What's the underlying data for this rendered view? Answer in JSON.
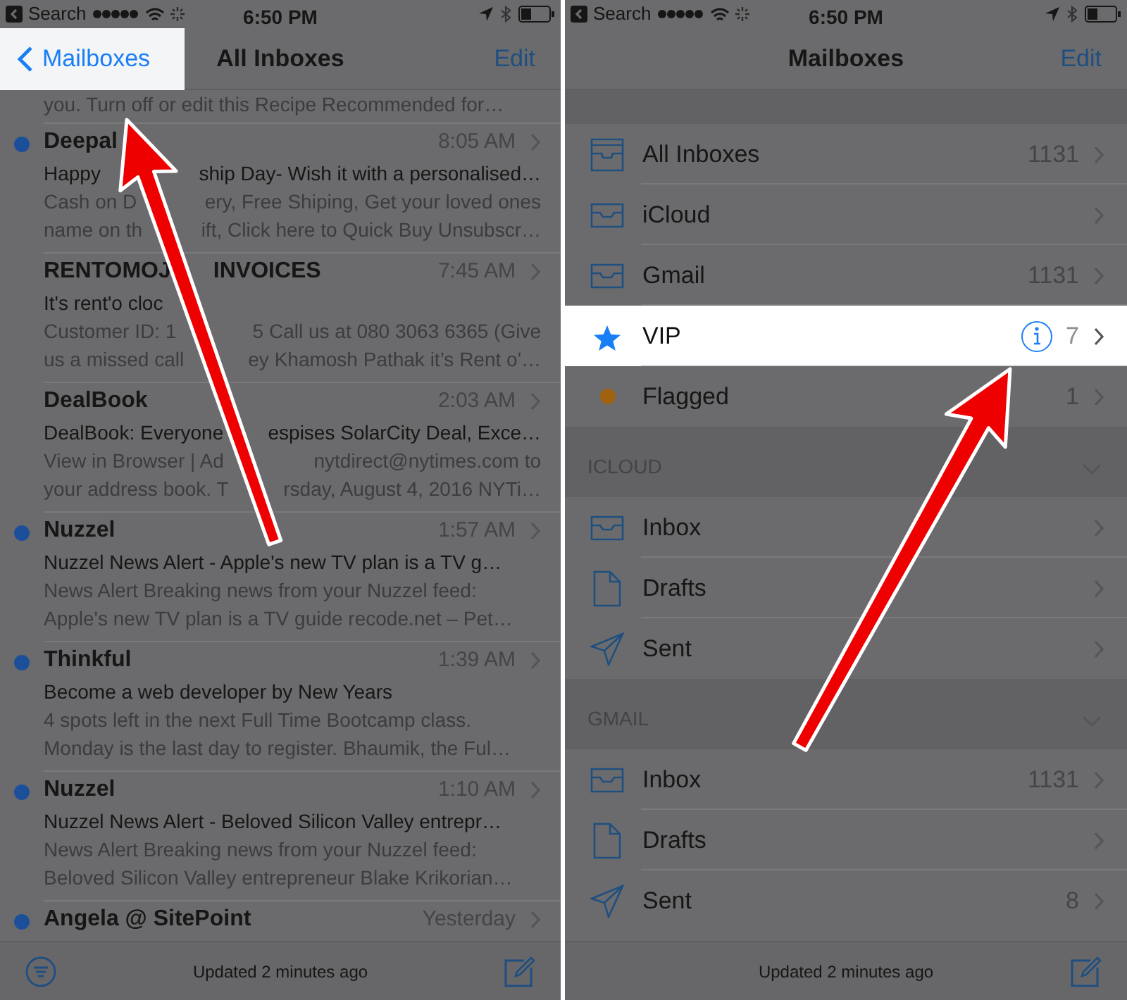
{
  "left_screen": {
    "status_bar": {
      "back_label": "Search",
      "time": "6:50 PM"
    },
    "nav": {
      "back": {
        "label": "Mailboxes",
        "highlighted": true
      },
      "title": "All Inboxes",
      "action": "Edit"
    },
    "partial_line": "you. Turn off or edit this Recipe Recommended for…",
    "messages": [
      {
        "sender": [
          "Deepal"
        ],
        "time": "8:05 AM",
        "unread": true,
        "subject": [
          "Happy",
          "ship Day- Wish it with a personalised…"
        ],
        "preview": [
          [
            "Cash on D",
            "ery, Free Shiping, Get your loved ones"
          ],
          [
            "name on th",
            "ift, Click here to Quick Buy Unsubscr…"
          ]
        ]
      },
      {
        "sender": [
          "RENTOMOJ",
          "INVOICES"
        ],
        "time": "7:45 AM",
        "unread": false,
        "subject": [
          "It's rent'o cloc"
        ],
        "preview": [
          [
            "Customer ID: 1",
            "5 Call us at 080 3063 6365 (Give"
          ],
          [
            "us a missed call",
            "ey Khamosh Pathak it’s Rent o'…"
          ]
        ]
      },
      {
        "sender": [
          "DealBook"
        ],
        "time": "2:03 AM",
        "unread": false,
        "subject": [
          "DealBook: Everyone",
          "espises SolarCity Deal, Exce…"
        ],
        "preview": [
          [
            "View in Browser | Ad",
            "nytdirect@nytimes.com to"
          ],
          [
            "your address book. T",
            "rsday, August 4, 2016 NYTi…"
          ]
        ]
      },
      {
        "sender": [
          "Nuzzel"
        ],
        "time": "1:57 AM",
        "unread": true,
        "subject": [
          "Nuzzel News Alert - Apple's new TV plan is a TV g…"
        ],
        "preview": [
          [
            "News Alert Breaking news from your Nuzzel feed:"
          ],
          [
            "Apple's new TV plan is a TV guide recode.net – Pet…"
          ]
        ]
      },
      {
        "sender": [
          "Thinkful"
        ],
        "time": "1:39 AM",
        "unread": true,
        "subject": [
          "Become a web developer by New Years"
        ],
        "preview": [
          [
            "4 spots left in the next Full Time Bootcamp class."
          ],
          [
            "Monday is the last day to register. Bhaumik, the Ful…"
          ]
        ]
      },
      {
        "sender": [
          "Nuzzel"
        ],
        "time": "1:10 AM",
        "unread": true,
        "subject": [
          "Nuzzel News Alert - Beloved Silicon Valley entrepr…"
        ],
        "preview": [
          [
            "News Alert Breaking news from your Nuzzel feed:"
          ],
          [
            "Beloved Silicon Valley entrepreneur Blake Krikorian…"
          ]
        ]
      },
      {
        "sender": [
          "Angela @ SitePoint"
        ],
        "time": "Yesterday",
        "unread": true
      }
    ],
    "toolbar": {
      "status": "Updated 2 minutes ago"
    }
  },
  "right_screen": {
    "status_bar": {
      "back_label": "Search",
      "time": "6:50 PM"
    },
    "nav": {
      "title": "Mailboxes",
      "action": "Edit"
    },
    "groups": [
      {
        "rows": [
          {
            "kind": "all_inboxes",
            "label": "All Inboxes",
            "count": "1131",
            "highlighted": false,
            "info_button": false
          },
          {
            "kind": "inbox",
            "label": "iCloud",
            "highlighted": false,
            "info_button": false
          },
          {
            "kind": "inbox",
            "label": "Gmail",
            "count": "1131",
            "highlighted": false,
            "info_button": false
          },
          {
            "kind": "star",
            "label": "VIP",
            "count": "7",
            "highlighted": true,
            "info_button": true
          },
          {
            "kind": "dot",
            "color": "#a0620f",
            "label": "Flagged",
            "count": "1",
            "highlighted": false,
            "info_button": false
          }
        ]
      },
      {
        "header": "ICLOUD",
        "expanded": true,
        "rows": [
          {
            "kind": "inbox",
            "label": "Inbox",
            "highlighted": false,
            "info_button": false
          },
          {
            "kind": "document",
            "label": "Drafts",
            "highlighted": false,
            "info_button": false
          },
          {
            "kind": "sent",
            "label": "Sent",
            "highlighted": false,
            "info_button": false
          }
        ]
      },
      {
        "header": "GMAIL",
        "expanded": true,
        "rows": [
          {
            "kind": "inbox",
            "label": "Inbox",
            "count": "1131",
            "highlighted": false,
            "info_button": false
          },
          {
            "kind": "document",
            "label": "Drafts",
            "highlighted": false,
            "info_button": false
          },
          {
            "kind": "sent",
            "label": "Sent",
            "count": "8",
            "highlighted": false,
            "info_button": false
          }
        ]
      }
    ],
    "toolbar": {
      "status": "Updated 2 minutes ago"
    }
  }
}
